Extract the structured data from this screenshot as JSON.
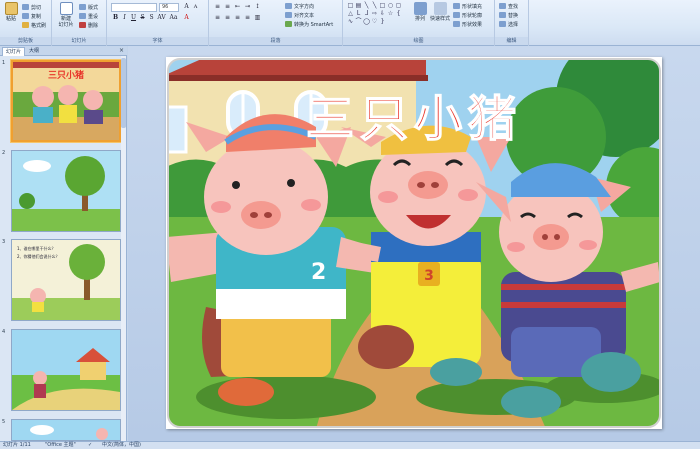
{
  "ribbon": {
    "clipboard": {
      "paste_label": "粘贴",
      "cut_label": "剪切",
      "copy_label": "复制",
      "format_painter_label": "格式刷",
      "group_label": "剪贴板"
    },
    "slides": {
      "new_slide_label": "新建\n幻灯片",
      "layout_label": "版式",
      "reset_label": "重设",
      "delete_label": "删除",
      "group_label": "幻灯片"
    },
    "font": {
      "font_size_value": "96",
      "group_label": "字体"
    },
    "paragraph": {
      "text_direction_label": "文字方向",
      "align_text_label": "对齐文本",
      "convert_smartart_label": "转换为 SmartArt",
      "group_label": "段落"
    },
    "drawing": {
      "arrange_label": "排列",
      "quick_styles_label": "快速样式",
      "shape_fill_label": "形状填充",
      "shape_outline_label": "形状轮廓",
      "shape_effects_label": "形状效果",
      "group_label": "绘图"
    },
    "editing": {
      "find_label": "查找",
      "replace_label": "替换",
      "select_label": "选择",
      "group_label": "编辑"
    }
  },
  "left_panel": {
    "tab_slides": "幻灯片",
    "tab_outline": "大纲",
    "close_glyph": "×",
    "thumbnails": [
      {
        "num": "1"
      },
      {
        "num": "2"
      },
      {
        "num": "3",
        "lines": [
          "1、谁在哪里干什么？",
          "2、你猜他们会说什么？"
        ]
      },
      {
        "num": "4"
      },
      {
        "num": "5"
      }
    ]
  },
  "slide": {
    "title": "三只小猪",
    "pig_numbers": [
      "2",
      "3"
    ]
  },
  "status_bar": {
    "slide_counter": "幻灯片 1/11",
    "theme": "\"Office 主题\"",
    "language": "中文(简体，中国)"
  },
  "colors": {
    "ribbon_bg": "#dbe8f7",
    "title_red": "#e8352a",
    "selection_orange": "#f0a030"
  }
}
